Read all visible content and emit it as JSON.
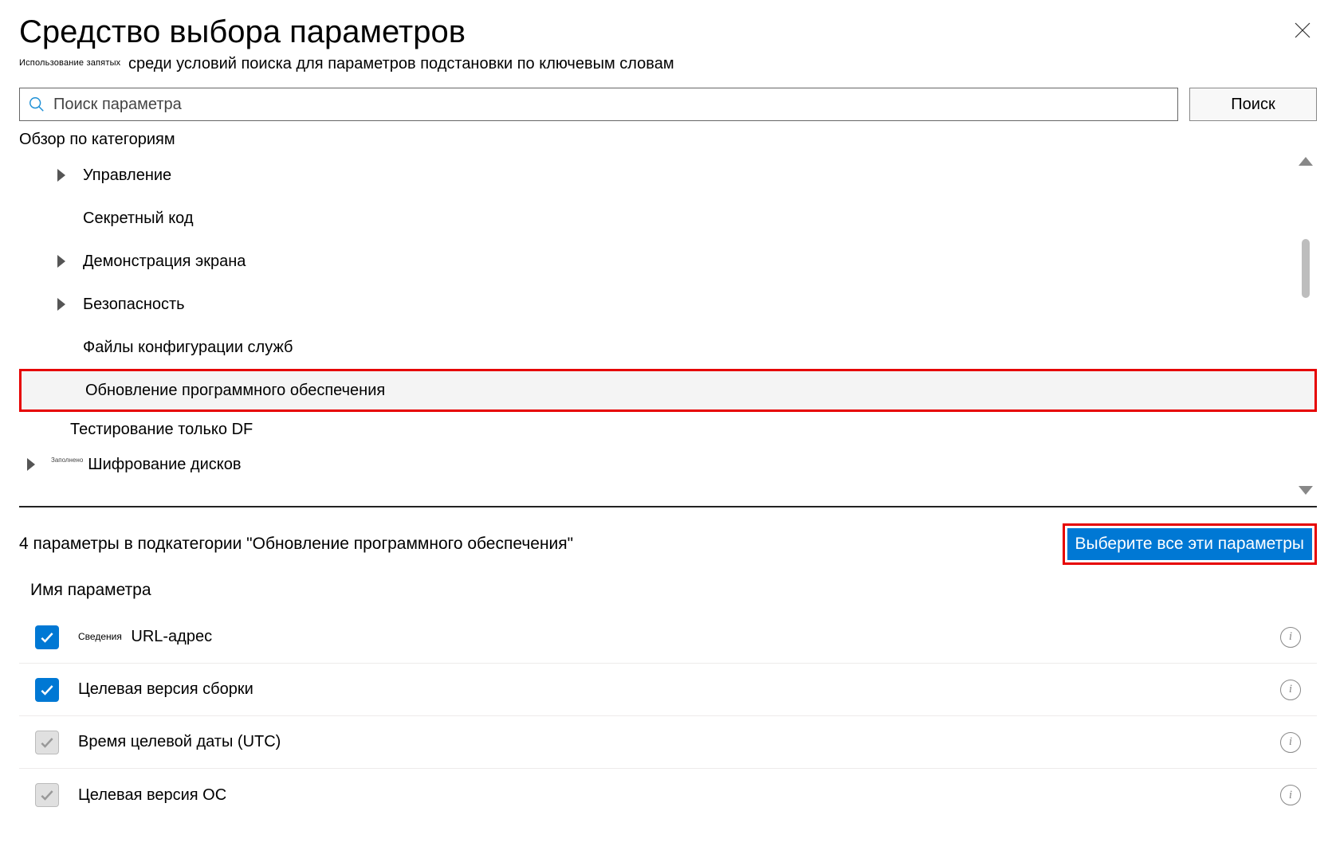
{
  "header": {
    "title": "Средство выбора параметров",
    "subtitle_prefix_small": "Использование запятых",
    "subtitle_rest": "среди условий поиска для параметров подстановки по ключевым словам"
  },
  "search": {
    "placeholder": "Поиск параметра",
    "button": "Поиск"
  },
  "browse_heading": "Обзор по категориям",
  "tree": [
    {
      "label": "Управление",
      "expandable": true,
      "selected": false
    },
    {
      "label": "Секретный код",
      "expandable": false,
      "selected": false
    },
    {
      "label": "Демонстрация экрана",
      "expandable": true,
      "selected": false
    },
    {
      "label": "Безопасность",
      "expandable": true,
      "selected": false
    },
    {
      "label": "Файлы конфигурации служб",
      "expandable": false,
      "selected": false
    },
    {
      "label": "Обновление программного обеспечения",
      "expandable": false,
      "selected": true
    },
    {
      "label": "Тестирование только DF",
      "expandable": false,
      "selected": false,
      "indent": true
    },
    {
      "label": "Шифрование дисков",
      "expandable": true,
      "selected": false,
      "done_prefix": "Заполнено"
    }
  ],
  "results": {
    "summary": "4 параметры в подкатегории \"Обновление программного обеспечения\"",
    "select_all_button": "Выберите все эти параметры",
    "column_header": "Имя параметра",
    "items": [
      {
        "checked": true,
        "prefix_small": "Сведения",
        "label": "URL-адрес"
      },
      {
        "checked": true,
        "label": "Целевая версия сборки"
      },
      {
        "checked": false,
        "label": "Время целевой даты (UTC)"
      },
      {
        "checked": false,
        "label": "Целевая версия ОС"
      }
    ]
  }
}
